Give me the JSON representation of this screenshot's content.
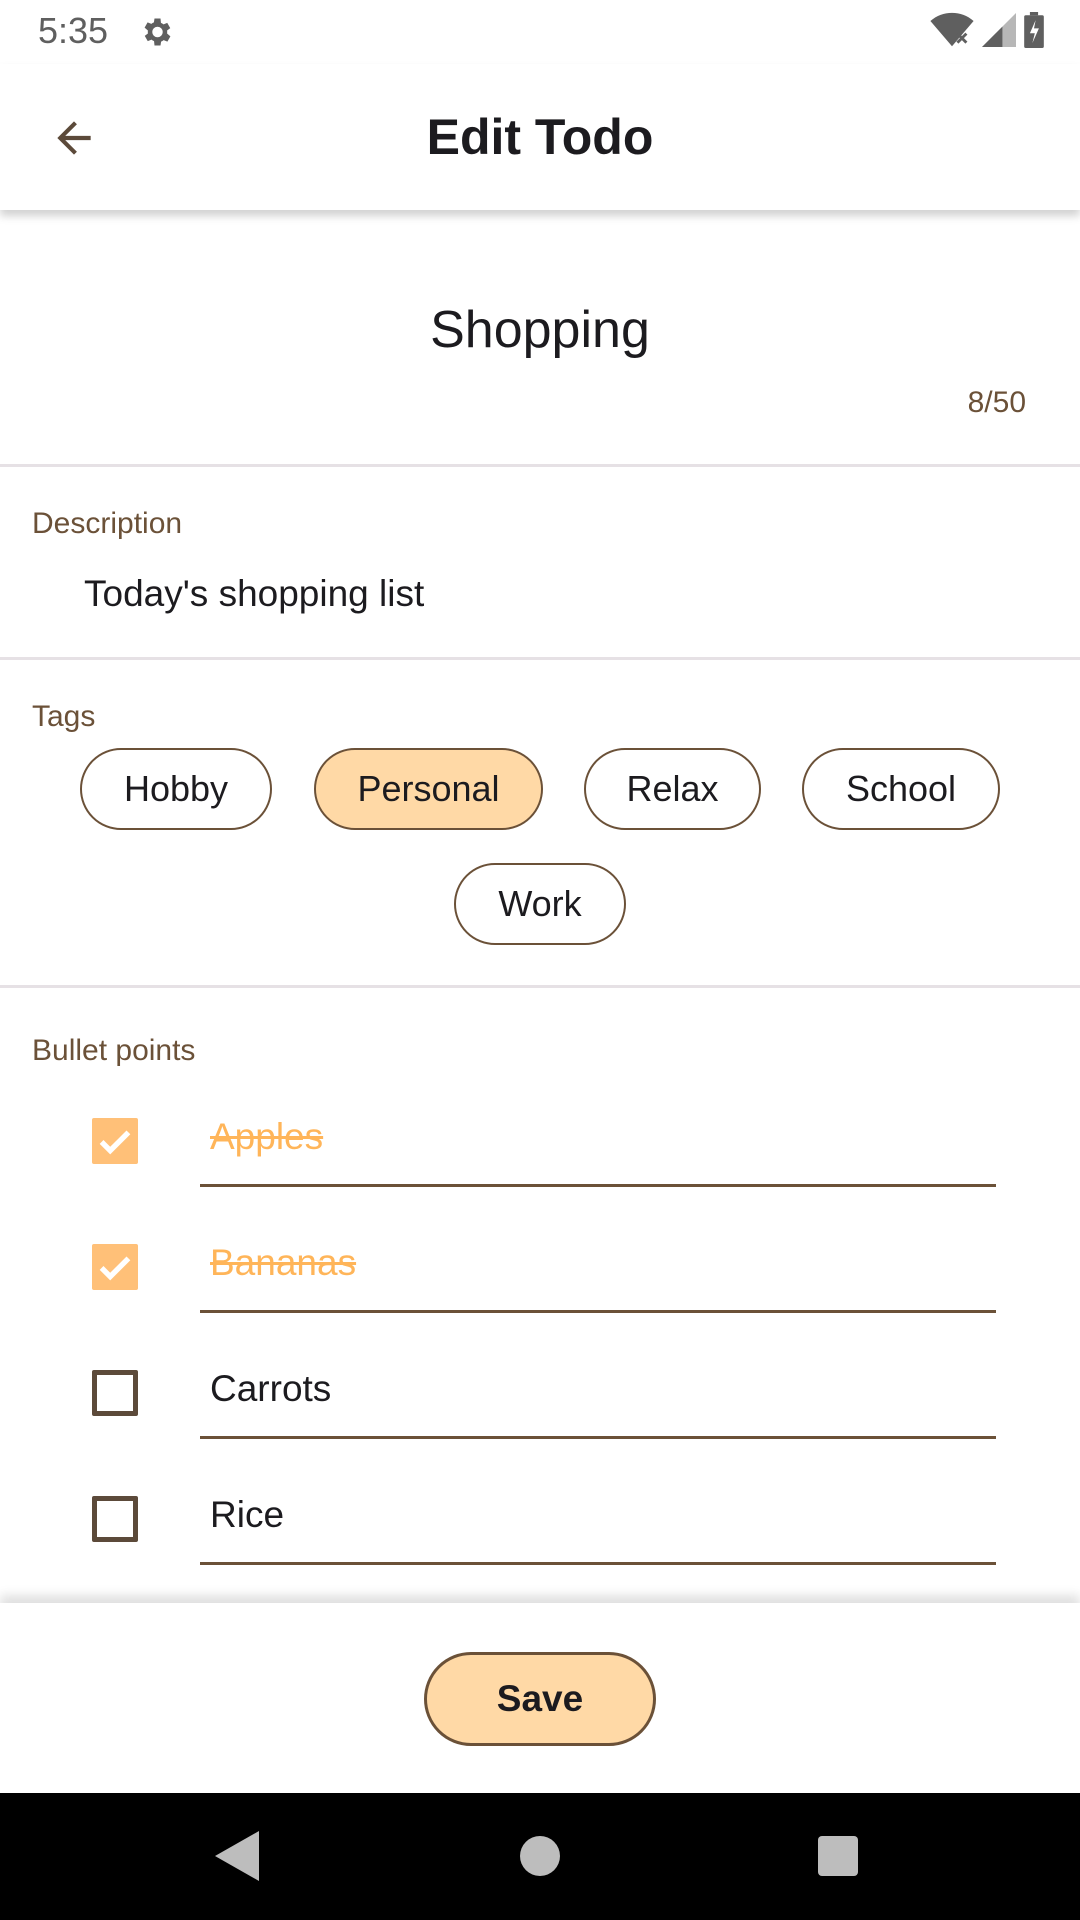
{
  "status_bar": {
    "time": "5:35",
    "icons": [
      "settings-icon",
      "wifi-icon",
      "signal-icon",
      "battery-icon"
    ]
  },
  "app_bar": {
    "title": "Edit Todo"
  },
  "todo": {
    "title": "Shopping",
    "title_counter": "8/50",
    "description_label": "Description",
    "description": "Today's shopping list"
  },
  "tags": {
    "label": "Tags",
    "items": [
      {
        "label": "Hobby",
        "selected": false
      },
      {
        "label": "Personal",
        "selected": true
      },
      {
        "label": "Relax",
        "selected": false
      },
      {
        "label": "School",
        "selected": false
      },
      {
        "label": "Work",
        "selected": false
      }
    ]
  },
  "bullets": {
    "label": "Bullet points",
    "items": [
      {
        "text": "Apples",
        "checked": true
      },
      {
        "text": "Bananas",
        "checked": true
      },
      {
        "text": "Carrots",
        "checked": false
      },
      {
        "text": "Rice",
        "checked": false
      }
    ]
  },
  "actions": {
    "save_label": "Save"
  },
  "colors": {
    "accent": "#ffd9a6",
    "checked": "#ffc078",
    "checked_text": "#ffb559",
    "brown": "#6b5138"
  }
}
